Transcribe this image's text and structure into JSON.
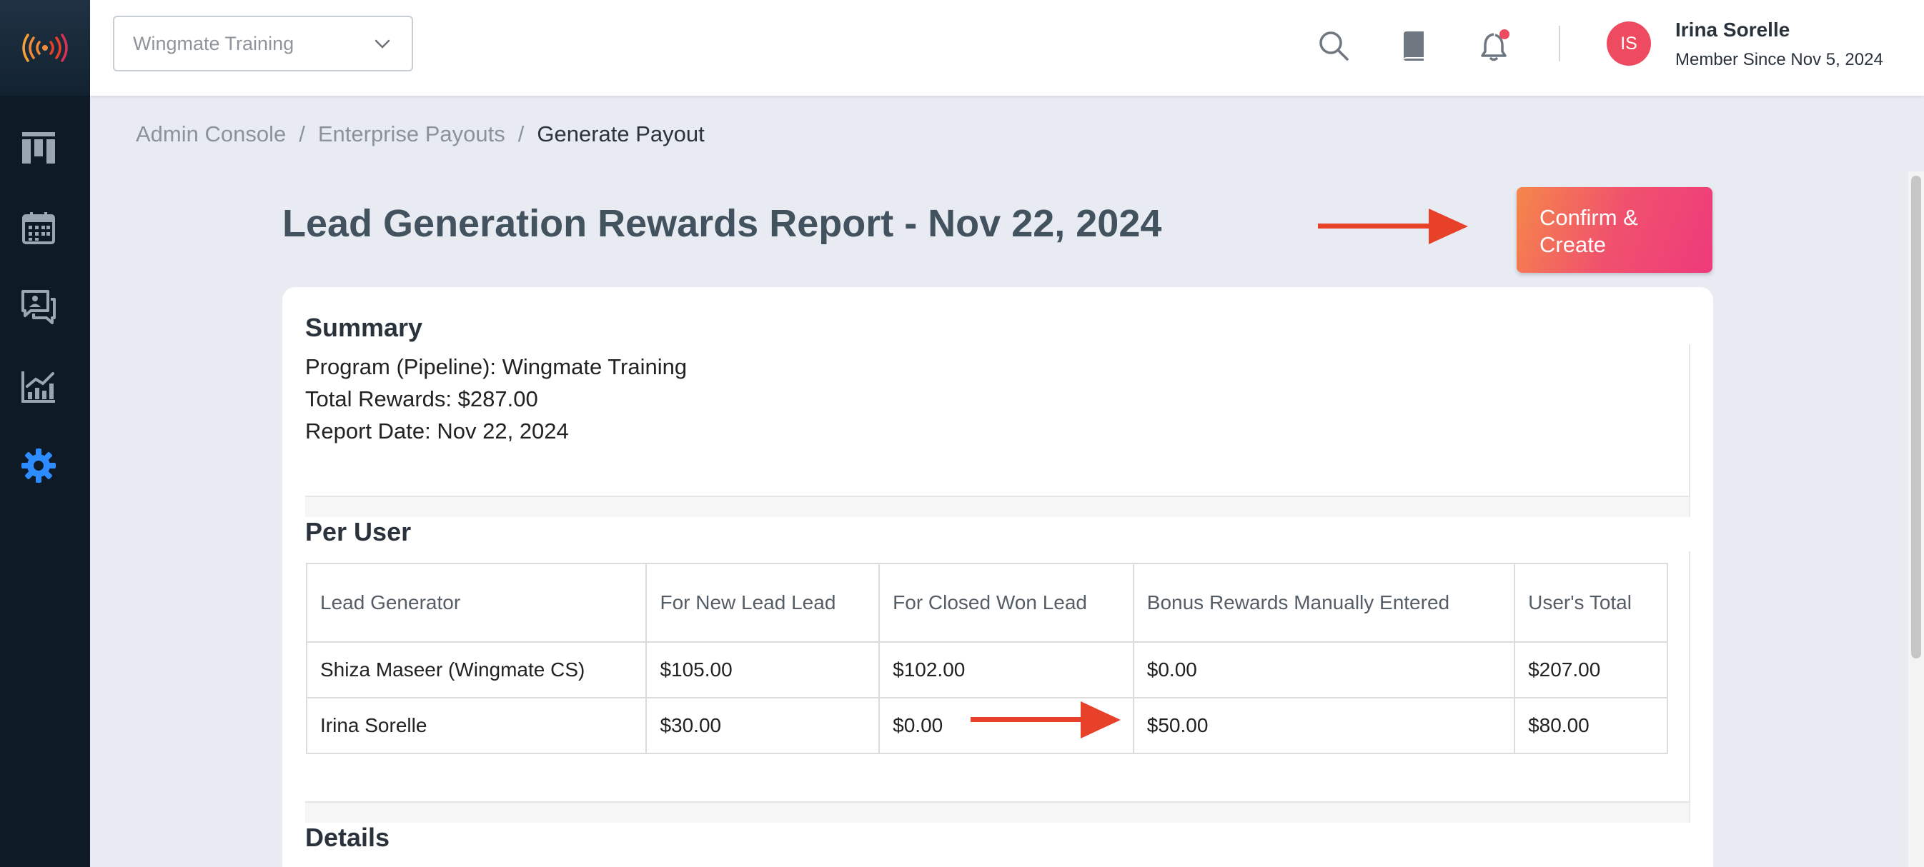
{
  "topbar": {
    "program_select": "Wingmate Training",
    "user": {
      "initials": "IS",
      "name": "Irina Sorelle",
      "member_since": "Member Since Nov 5, 2024"
    }
  },
  "breadcrumb": {
    "items": [
      "Admin Console",
      "Enterprise Payouts",
      "Generate Payout"
    ]
  },
  "page": {
    "title": "Lead Generation Rewards Report - Nov 22, 2024",
    "confirm_button": "Confirm & Create"
  },
  "summary": {
    "title": "Summary",
    "program": "Program (Pipeline): Wingmate Training",
    "total_rewards": "Total Rewards: $287.00",
    "report_date": "Report Date: Nov 22, 2024"
  },
  "per_user": {
    "title": "Per User",
    "headers": [
      "Lead Generator",
      "For New Lead Lead",
      "For Closed Won Lead",
      "Bonus Rewards Manually Entered",
      "User's Total"
    ],
    "rows": [
      [
        "Shiza Maseer (Wingmate CS)",
        "$105.00",
        "$102.00",
        "$0.00",
        "$207.00"
      ],
      [
        "Irina Sorelle",
        "$30.00",
        "$0.00",
        "$50.00",
        "$80.00"
      ]
    ]
  },
  "details": {
    "title": "Details"
  },
  "colors": {
    "sidebar_bg": "#0e1b26",
    "active_nav": "#2d8cff",
    "logo_accent": "#f08a3a",
    "avatar_bg": "#ee4b61",
    "annotation_arrow": "#e8412a",
    "button_gradient_start": "#f5874a",
    "button_gradient_end": "#ee3a7c"
  },
  "icons": {
    "logo": "broadcast-logo-icon",
    "nav": [
      "board-icon",
      "calendar-icon",
      "chat-icon",
      "analytics-icon",
      "gear-icon"
    ],
    "top": [
      "search-icon",
      "book-icon",
      "bell-icon"
    ]
  }
}
